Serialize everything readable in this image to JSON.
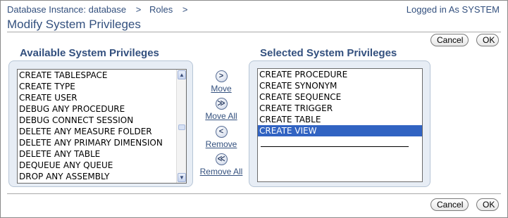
{
  "breadcrumb": {
    "instance": "Database Instance: database",
    "sep1": ">",
    "roles": "Roles",
    "sep2": ">"
  },
  "header": {
    "logged_in": "Logged in As SYSTEM",
    "title": "Modify System Privileges"
  },
  "buttons": {
    "cancel": "Cancel",
    "ok": "OK"
  },
  "available": {
    "title": "Available System Privileges",
    "items": [
      "CREATE TABLESPACE",
      "CREATE TYPE",
      "CREATE USER",
      "DEBUG ANY PROCEDURE",
      "DEBUG CONNECT SESSION",
      "DELETE ANY MEASURE FOLDER",
      "DELETE ANY PRIMARY DIMENSION",
      "DELETE ANY TABLE",
      "DEQUEUE ANY QUEUE",
      "DROP ANY ASSEMBLY"
    ]
  },
  "selected": {
    "title": "Selected System Privileges",
    "items": [
      "CREATE PROCEDURE",
      "CREATE SYNONYM",
      "CREATE SEQUENCE",
      "CREATE TRIGGER",
      "CREATE TABLE",
      "CREATE VIEW"
    ],
    "highlighted": "CREATE VIEW"
  },
  "shuttle": {
    "move_icon": ">",
    "move": "Move",
    "move_all_icon": "≫",
    "move_all": "Move All",
    "remove_icon": "<",
    "remove": "Remove",
    "remove_all_icon": "≪",
    "remove_all": "Remove All"
  },
  "colors": {
    "link": "#33507e",
    "selection": "#3163c2",
    "panel_bg": "#e7edf5"
  }
}
